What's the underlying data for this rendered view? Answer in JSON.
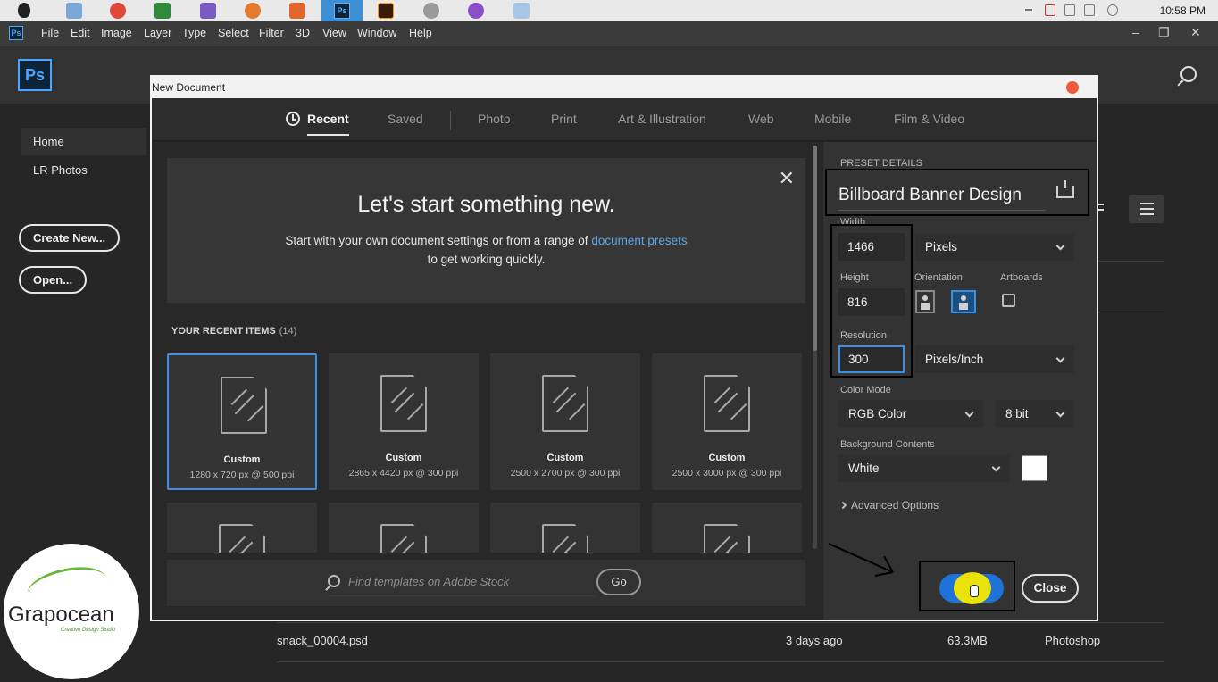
{
  "system": {
    "clock": "10:58 PM"
  },
  "menubar": {
    "app_logo": "Ps",
    "items": [
      "File",
      "Edit",
      "Image",
      "Layer",
      "Type",
      "Select",
      "Filter",
      "3D",
      "View",
      "Window",
      "Help"
    ],
    "window_controls": [
      "–",
      "❐",
      "✕"
    ]
  },
  "home": {
    "logo": "Ps",
    "nav": [
      {
        "label": "Home",
        "active": true
      },
      {
        "label": "LR Photos",
        "active": false
      }
    ],
    "create_new_label": "Create New...",
    "open_label": "Open...",
    "files": [
      {
        "name": "snack_00004.psd",
        "date": "3 days ago",
        "size": "63.3MB",
        "kind": "Photoshop"
      }
    ]
  },
  "dialog": {
    "title": "New Document",
    "tabs": [
      {
        "label": "Recent",
        "active": true
      },
      {
        "label": "Saved",
        "active": false
      },
      {
        "label": "Photo",
        "active": false
      },
      {
        "label": "Print",
        "active": false
      },
      {
        "label": "Art & Illustration",
        "active": false
      },
      {
        "label": "Web",
        "active": false
      },
      {
        "label": "Mobile",
        "active": false
      },
      {
        "label": "Film & Video",
        "active": false
      }
    ],
    "hero": {
      "title": "Let's start something new.",
      "subtitle_before": "Start with your own document settings or from a range of",
      "subtitle_link": "document presets",
      "subtitle_after": "to get working quickly."
    },
    "recent": {
      "heading": "YOUR RECENT ITEMS",
      "count": "(14)",
      "items": [
        {
          "name": "Custom",
          "dims": "1280 x 720 px @ 500 ppi",
          "selected": true
        },
        {
          "name": "Custom",
          "dims": "2865 x 4420 px @ 300 ppi",
          "selected": false
        },
        {
          "name": "Custom",
          "dims": "2500 x 2700 px @ 300 ppi",
          "selected": false
        },
        {
          "name": "Custom",
          "dims": "2500 x 3000 px @ 300 ppi",
          "selected": false
        }
      ]
    },
    "stock": {
      "placeholder": "Find templates on Adobe Stock",
      "go_label": "Go"
    },
    "preset": {
      "section_label": "PRESET DETAILS",
      "name": "Billboard Banner Design",
      "width_label": "Width",
      "width_value": "1466",
      "width_unit": "Pixels",
      "height_label": "Height",
      "height_value": "816",
      "orientation_label": "Orientation",
      "artboards_label": "Artboards",
      "resolution_label": "Resolution",
      "resolution_value": "300",
      "resolution_unit": "Pixels/Inch",
      "color_mode_label": "Color Mode",
      "color_mode": "RGB Color",
      "bit_depth": "8 bit",
      "background_label": "Background Contents",
      "background": "White",
      "advanced_label": "Advanced Options",
      "close_label": "Close"
    }
  },
  "watermark": {
    "title": "Grapocean",
    "subtitle": "Creative Design Studio"
  },
  "colors": {
    "accent": "#3a8fe6",
    "create_button": "#1d73d8",
    "highlight": "#f5e900",
    "close_dot": "#f0593c"
  },
  "icons": {
    "search": "search-icon",
    "clock": "clock-icon",
    "close": "close-icon",
    "save_preset": "save-preset-icon",
    "document": "document-icon",
    "chevron": "chevron-down-icon"
  }
}
